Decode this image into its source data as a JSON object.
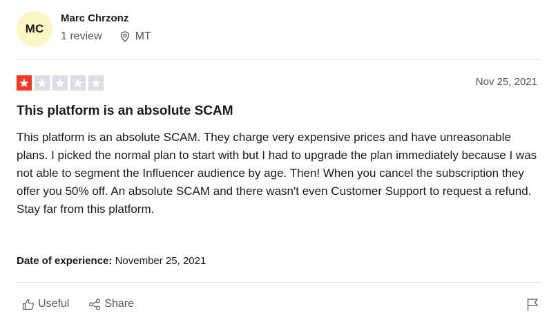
{
  "reviewer": {
    "initials": "MC",
    "name": "Marc Chrzonz",
    "review_count": "1 review",
    "location": "MT"
  },
  "review": {
    "rating": 1,
    "max_rating": 5,
    "date": "Nov 25, 2021",
    "title": "This platform is an absolute SCAM",
    "body_lines": [
      "This platform is an absolute SCAM. They charge very expensive prices and have unreasonable plans. I picked the normal plan to start with but I had to upgrade the plan immediately because I was not able to segment the Influencer audience by age. Then! When you cancel the subscription they offer you 50% off. An absolute SCAM and there wasn't even Customer Support to request a refund.",
      "Stay far from this platform."
    ],
    "experience_label": "Date of experience:",
    "experience_date": "November 25, 2021"
  },
  "actions": {
    "useful_label": "Useful",
    "share_label": "Share"
  },
  "icons": {
    "location": "location-pin-icon",
    "useful": "thumbs-up-icon",
    "share": "share-icon",
    "flag": "flag-icon"
  },
  "colors": {
    "star_filled": "#ff3722",
    "star_empty": "#dcdce6",
    "avatar_bg": "#fcf6c4"
  }
}
